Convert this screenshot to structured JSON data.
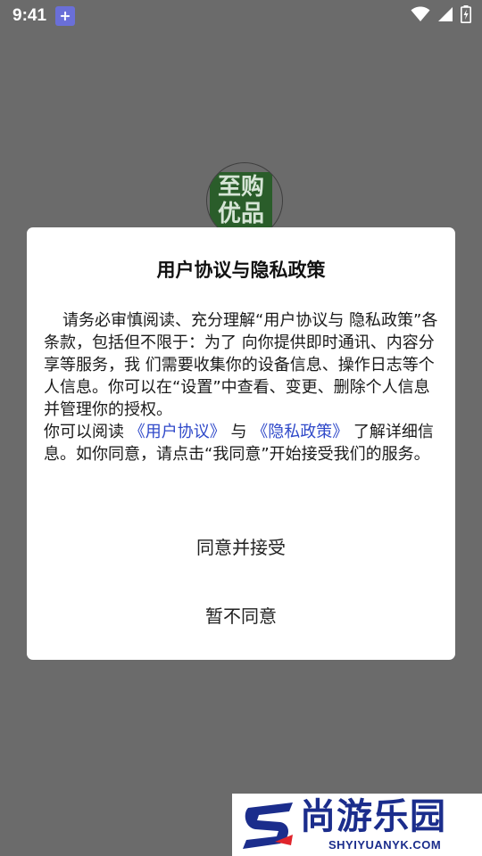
{
  "status_bar": {
    "time": "9:41",
    "icons": [
      "fan-notification-icon",
      "wifi-icon",
      "signal-icon",
      "battery-charging-icon"
    ]
  },
  "splash": {
    "logo_line1": "至购",
    "logo_line2": "优品"
  },
  "dialog": {
    "title": "用户协议与隐私政策",
    "paragraph1": "请务必审慎阅读、充分理解“用户协议与 隐私政策”各条款，包括但不限于：为了 向你提供即时通讯、内容分享等服务，我 们需要收集你的设备信息、操作日志等个 人信息。你可以在“设置”中查看、变更、删除个人信息并管理你的授权。",
    "paragraph2_prefix": "你可以阅读",
    "user_agreement_link": "《用户协议》",
    "paragraph2_and": "与",
    "privacy_policy_link": "《隐私政策》",
    "paragraph2_suffix": "了解详细信息。如你同意，请点击“我同意”开始接受我们的服务。",
    "agree_button": "同意并接受",
    "decline_button": "暂不同意"
  },
  "watermark": {
    "title": "尚游乐园",
    "url": "SHYIYUANYK.COM"
  },
  "colors": {
    "overlay": "#6b6b6b",
    "link": "#2f49c9",
    "watermark_blue": "#1b2d8c",
    "watermark_red": "#e0242b"
  }
}
